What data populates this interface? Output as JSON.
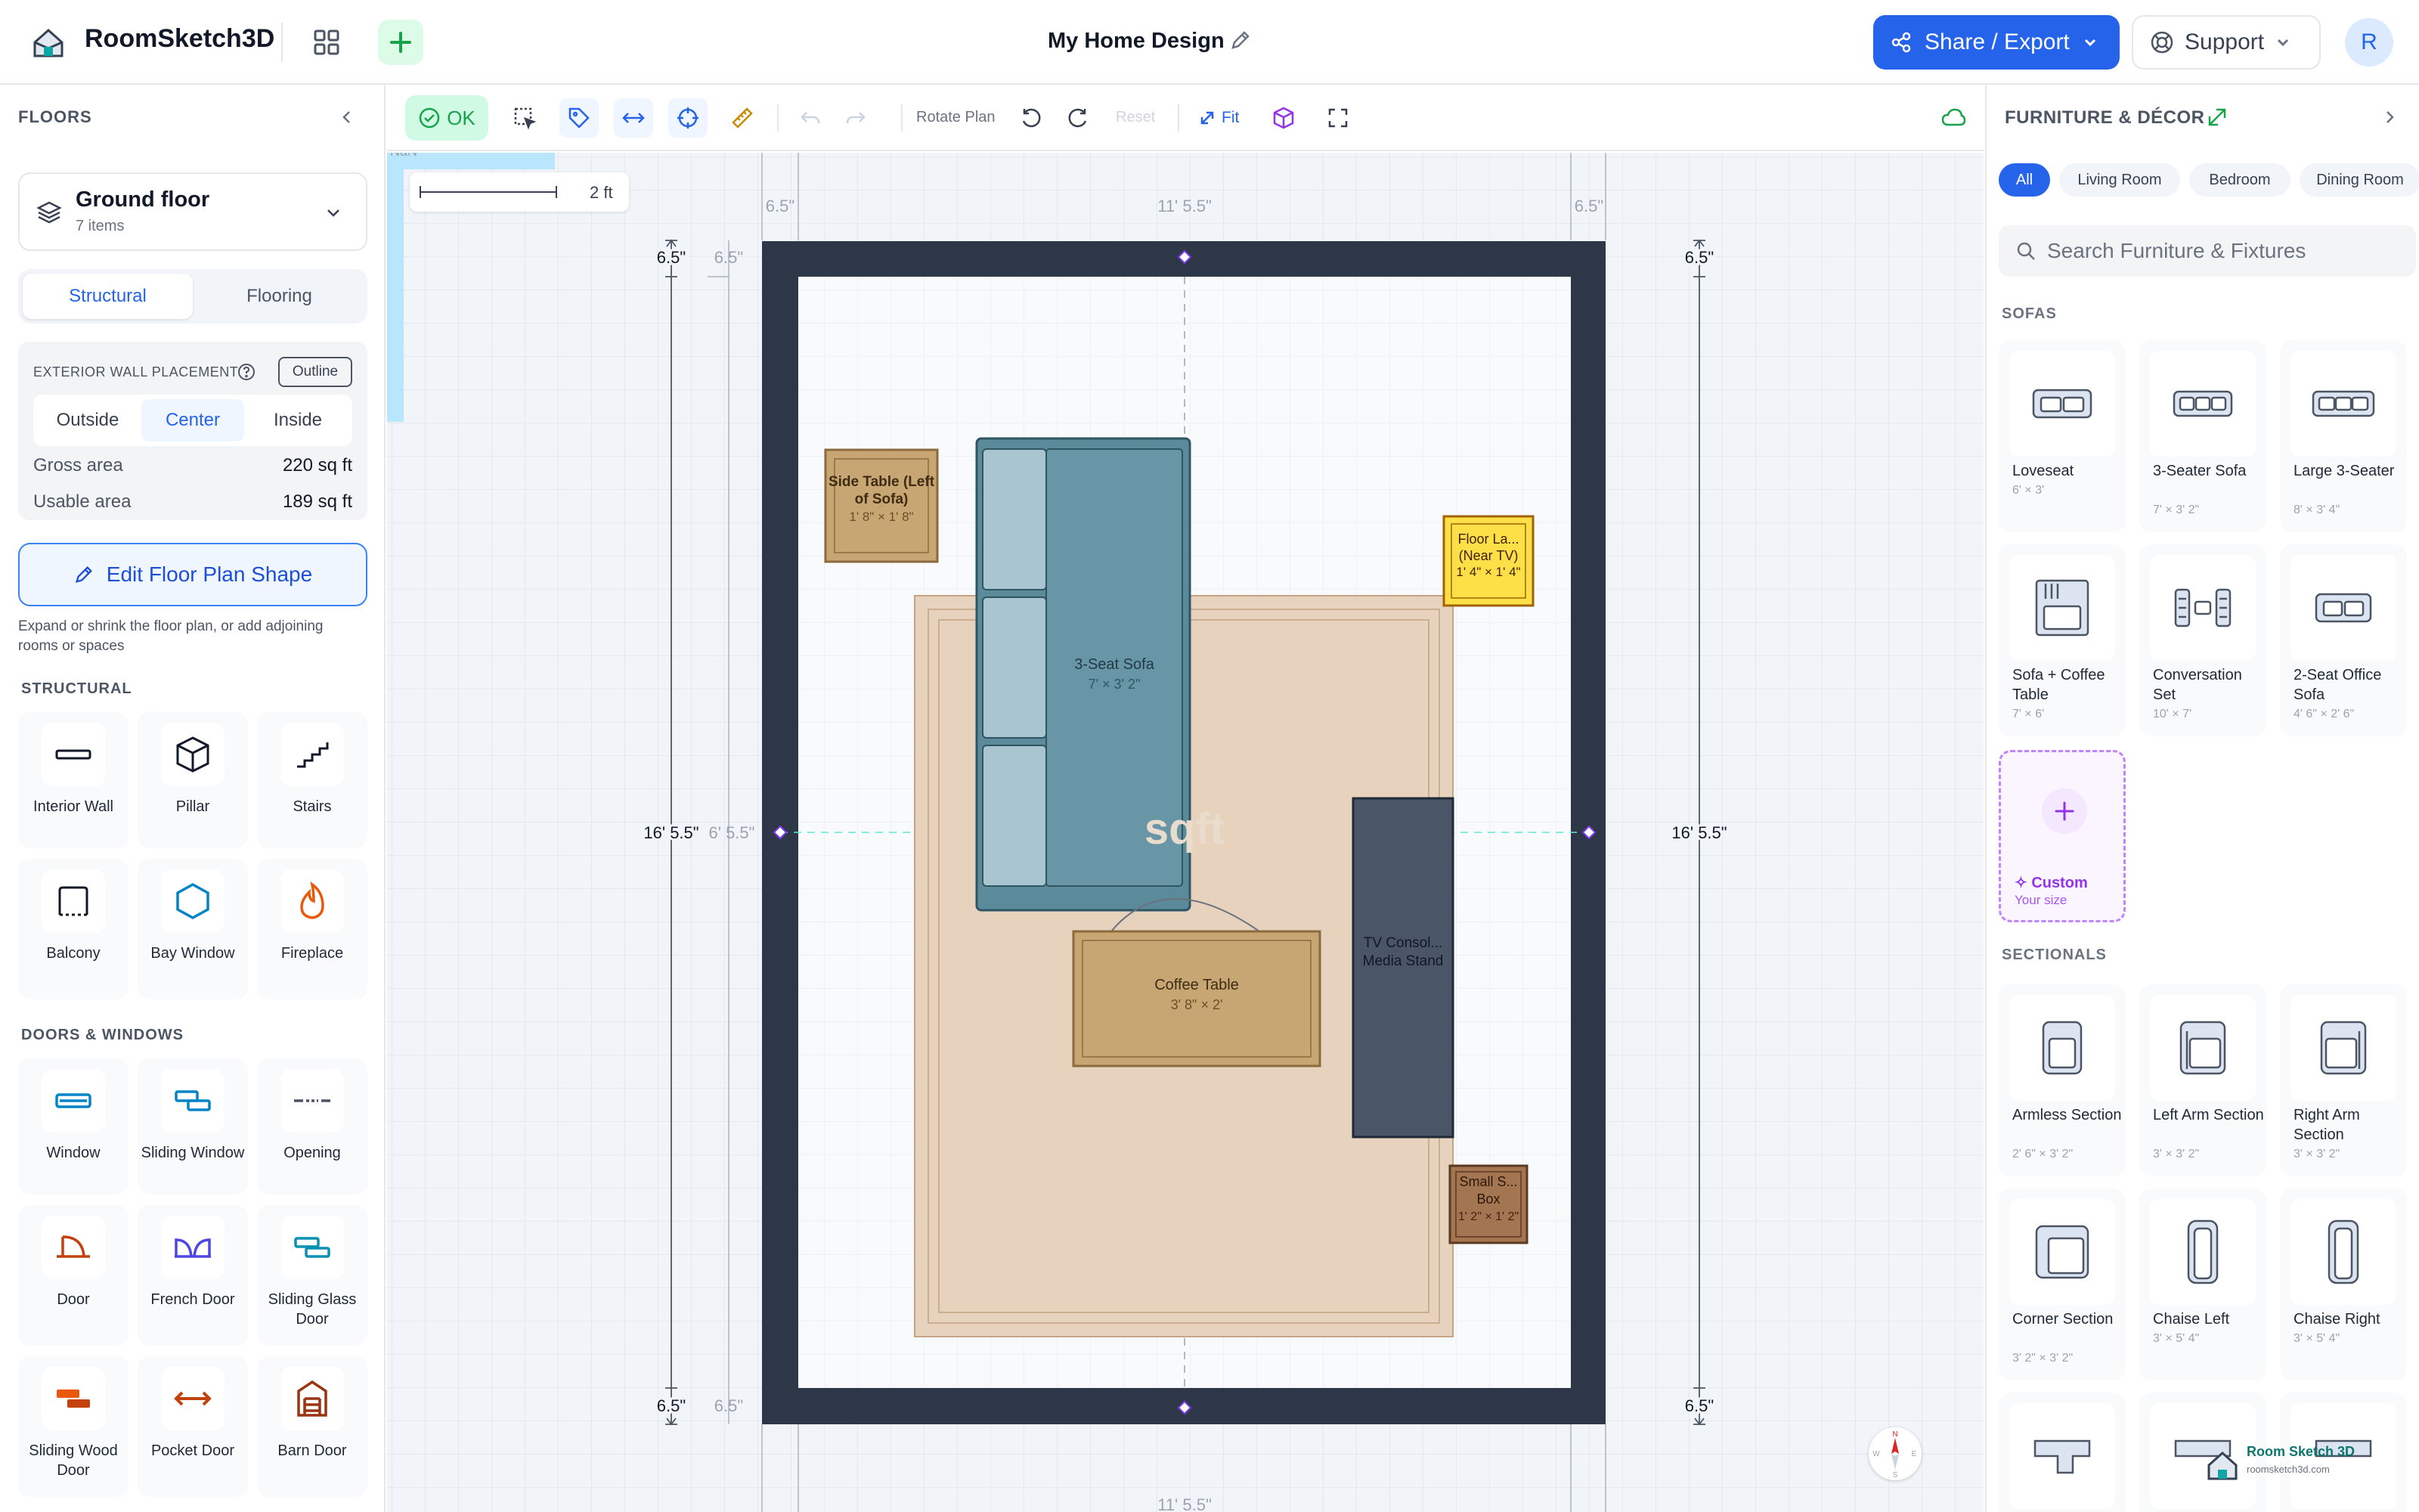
{
  "header": {
    "app_name": "RoomSketch3D",
    "design_title": "My Home Design",
    "share_label": "Share / Export",
    "support_label": "Support",
    "avatar_initial": "R"
  },
  "left": {
    "floors_title": "FLOORS",
    "floor": {
      "name": "Ground floor",
      "count": "7 items"
    },
    "tabs": [
      "Structural",
      "Flooring"
    ],
    "wall_placement_title": "EXTERIOR WALL PLACEMENT",
    "outline_label": "Outline",
    "placement_options": [
      "Outside",
      "Center",
      "Inside"
    ],
    "selected_placement": "Center",
    "gross_label": "Gross area",
    "gross_value": "220 sq ft",
    "usable_label": "Usable area",
    "usable_value": "189 sq ft",
    "edit_shape_label": "Edit Floor Plan Shape",
    "edit_shape_hint": "Expand or shrink the floor plan, or add adjoining rooms or spaces",
    "structural_title": "STRUCTURAL",
    "structural_items": [
      {
        "label": "Interior Wall",
        "icon": "interior-wall-icon"
      },
      {
        "label": "Pillar",
        "icon": "pillar-icon"
      },
      {
        "label": "Stairs",
        "icon": "stairs-icon"
      },
      {
        "label": "Balcony",
        "icon": "balcony-icon"
      },
      {
        "label": "Bay Window",
        "icon": "bay-window-icon"
      },
      {
        "label": "Fireplace",
        "icon": "fireplace-icon"
      }
    ],
    "doors_title": "DOORS & WINDOWS",
    "door_items": [
      {
        "label": "Window",
        "icon": "window-icon"
      },
      {
        "label": "Sliding Window",
        "icon": "sliding-window-icon"
      },
      {
        "label": "Opening",
        "icon": "opening-icon"
      },
      {
        "label": "Door",
        "icon": "door-icon"
      },
      {
        "label": "French Door",
        "icon": "french-door-icon"
      },
      {
        "label": "Sliding Glass Door",
        "icon": "sliding-glass-door-icon"
      },
      {
        "label": "Sliding Wood Door",
        "icon": "sliding-wood-door-icon"
      },
      {
        "label": "Pocket Door",
        "icon": "pocket-door-icon"
      },
      {
        "label": "Barn Door",
        "icon": "barn-door-icon"
      }
    ]
  },
  "toolbar": {
    "ok_label": "OK",
    "rotate_label": "Rotate Plan",
    "reset_label": "Reset",
    "fit_label": "Fit"
  },
  "canvas": {
    "scale_label": "2 ft",
    "nan_label": "NaN",
    "room_width": "11' 5.5\"",
    "room_height": "16' 5.5\"",
    "wall_thickness": "6.5\"",
    "inner_width_mid": "6' 5.5\"",
    "area_watermark": "sqft",
    "compass": {
      "n": "N",
      "e": "E",
      "s": "S",
      "w": "W"
    },
    "items": {
      "side_table": {
        "name": "Side Table (Left of Sofa)",
        "dim": "1' 8\" × 1' 8\""
      },
      "sofa": {
        "name": "3-Seat Sofa",
        "dim": "7' × 3' 2\""
      },
      "floor_lamp": {
        "name": "Floor La... (Near TV)",
        "dim": "1' 4\" × 1' 4\""
      },
      "coffee_table": {
        "name": "Coffee Table",
        "dim": "3' 8\" × 2'"
      },
      "tv_console": {
        "name": "TV Consol... Media Stand",
        "dim": ""
      },
      "small_box": {
        "name": "Small S... Box",
        "dim": "1' 2\" × 1' 2\""
      }
    }
  },
  "right": {
    "title": "FURNITURE & DÉCOR",
    "filters": [
      "All",
      "Living Room",
      "Bedroom",
      "Dining Room"
    ],
    "active_filter": "All",
    "search_placeholder": "Search Furniture & Fixtures",
    "sofas_title": "SOFAS",
    "sofas": [
      {
        "name": "Loveseat",
        "dim": "6' × 3'"
      },
      {
        "name": "3-Seater Sofa",
        "dim": "7' × 3' 2\""
      },
      {
        "name": "Large 3-Seater",
        "dim": "8' × 3' 4\""
      },
      {
        "name": "Sofa + Coffee Table",
        "dim": "7' × 6'"
      },
      {
        "name": "Conversation Set",
        "dim": "10' × 7'"
      },
      {
        "name": "2-Seat Office Sofa",
        "dim": "4' 6\" × 2' 6\""
      }
    ],
    "custom": {
      "name": "Custom",
      "sub": "Your size"
    },
    "sectionals_title": "SECTIONALS",
    "sectionals": [
      {
        "name": "Armless Section",
        "dim": "2' 6\" × 3' 2\""
      },
      {
        "name": "Left Arm Section",
        "dim": "3' × 3' 2\""
      },
      {
        "name": "Right Arm Section",
        "dim": "3' × 3' 2\""
      },
      {
        "name": "Corner Section",
        "dim": "3' 2\" × 3' 2\""
      },
      {
        "name": "Chaise Left",
        "dim": "3' × 5' 4\""
      },
      {
        "name": "Chaise Right",
        "dim": "3' × 5' 4\""
      }
    ],
    "watermark": {
      "name": "Room Sketch 3D",
      "url": "roomsketch3d.com"
    }
  },
  "colors": {
    "accent": "#2563eb",
    "wall": "#2d3748",
    "sofa": "#5b8a9a",
    "rug": "#e6d2bd",
    "wood": "#c8a674",
    "lamp": "#fde047",
    "tv": "#4a5568"
  }
}
